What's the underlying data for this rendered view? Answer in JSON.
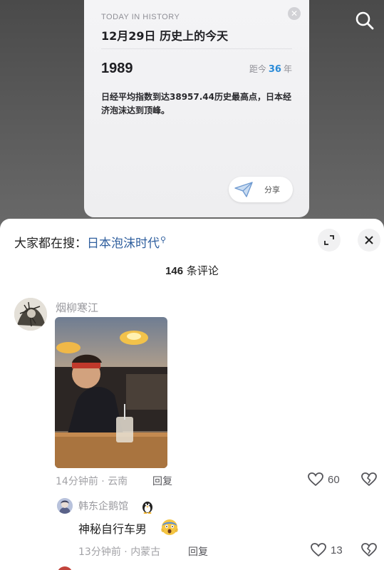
{
  "history_card": {
    "kicker": "TODAY IN HISTORY",
    "title": "12月29日  历史上的今天",
    "year": "1989",
    "since_prefix": "距今",
    "since_years": "36",
    "since_suffix": "年",
    "body": "日经平均指数到达38957.44历史最高点，日本经济泡沫达到顶峰。",
    "share_label": "分享",
    "close_icon": "close-icon",
    "share_icon": "paper-plane-icon"
  },
  "top_bar": {
    "search_icon": "search-icon"
  },
  "sheet": {
    "searching_prefix": "大家都在搜：",
    "searching_term": "日本泡沫时代",
    "expand_icon": "expand-icon",
    "close_icon": "close-icon",
    "count_number": "146",
    "count_suffix": "条评论"
  },
  "comments": [
    {
      "user": "烟柳寒江",
      "time": "14分钟前",
      "location": "云南",
      "reply_label": "回复",
      "likes": "60",
      "has_image": true
    },
    {
      "user": "韩东企鹅馆",
      "text": "神秘自行车男",
      "time": "13分钟前",
      "location": "内蒙古",
      "reply_label": "回复",
      "likes": "13"
    }
  ],
  "colors": {
    "accent_link": "#2f5f9e",
    "since_number": "#2a8bd8"
  }
}
